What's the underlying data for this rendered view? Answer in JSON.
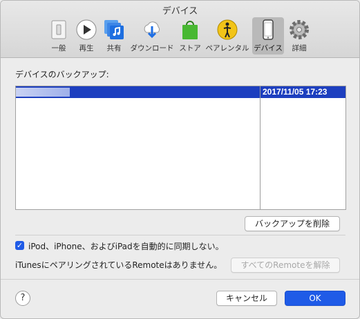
{
  "window": {
    "title": "デバイス"
  },
  "toolbar": {
    "tabs": [
      {
        "label": "一般",
        "icon": "switch-icon"
      },
      {
        "label": "再生",
        "icon": "play-icon"
      },
      {
        "label": "共有",
        "icon": "music-library-icon"
      },
      {
        "label": "ダウンロード",
        "icon": "cloud-download-icon"
      },
      {
        "label": "ストア",
        "icon": "shopping-bag-icon"
      },
      {
        "label": "ペアレンタル",
        "icon": "parental-icon"
      },
      {
        "label": "デバイス",
        "icon": "iphone-icon",
        "selected": true
      },
      {
        "label": "詳細",
        "icon": "gear-icon"
      }
    ]
  },
  "backup": {
    "label": "デバイスのバックアップ:",
    "rows": [
      {
        "name": "",
        "date": "2017/11/05 17:23",
        "selected": true
      }
    ],
    "delete_button": "バックアップを削除"
  },
  "sync": {
    "checkbox_label": "iPod、iPhone、およびiPadを自動的に同期しない。",
    "checked": true
  },
  "remote": {
    "text": "iTunesにペアリングされているRemoteはありません。",
    "reset_button": "すべてのRemoteを解除"
  },
  "footer": {
    "help": "?",
    "cancel": "キャンセル",
    "ok": "OK"
  },
  "colors": {
    "accent": "#1f5be7",
    "selection": "#1d3fbf"
  }
}
